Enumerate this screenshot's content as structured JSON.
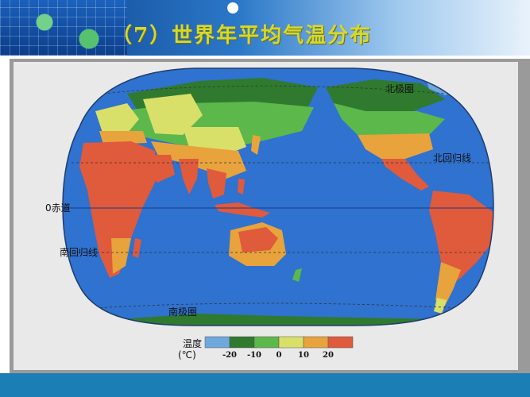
{
  "slide": {
    "title": "（7）世界年平均气温分布"
  },
  "map": {
    "labels": {
      "arctic": "北极圈",
      "tropic_cancer": "北回归线",
      "equator": "0赤道",
      "tropic_capricorn": "南回归线",
      "antarctic": "南极圈"
    }
  },
  "legend": {
    "title_line1": "温度",
    "title_line2": "(℃)",
    "ticks": [
      "-20",
      "-10",
      "0",
      "10",
      "20"
    ],
    "colors": [
      "#6fa8dc",
      "#2f7a2f",
      "#5cb84a",
      "#d9e06a",
      "#e8a33c",
      "#e05a3c"
    ]
  },
  "colors": {
    "ocean": "#2f72cf",
    "land_hot": "#e05a3c",
    "land_warm": "#e8a33c",
    "land_mild": "#d9e06a",
    "land_cool": "#5cb84a",
    "land_cold": "#2f7a2f",
    "ice": "#6fa8dc"
  }
}
